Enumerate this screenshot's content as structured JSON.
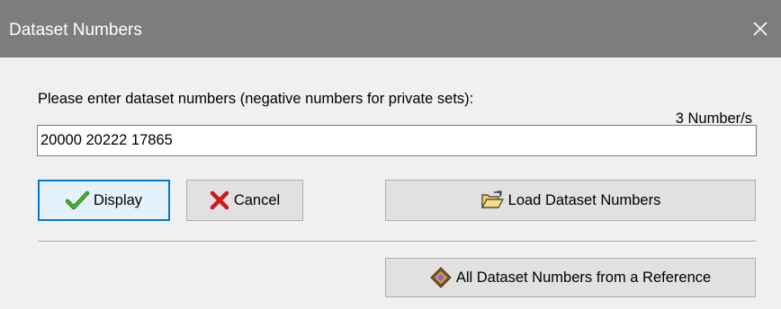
{
  "window": {
    "title": "Dataset Numbers",
    "close_icon": "close-icon"
  },
  "form": {
    "prompt": "Please enter dataset numbers (negative numbers for private sets):",
    "count_label": "3 Number/s",
    "input_value": "20000 20222 17865"
  },
  "buttons": {
    "display": {
      "label": "Display",
      "icon": "checkmark-icon",
      "icon_color": "#2e8b1f"
    },
    "cancel": {
      "label": "Cancel",
      "icon": "red-x-icon",
      "icon_color": "#cc1a1a"
    },
    "load": {
      "label": "Load Dataset Numbers",
      "icon": "open-folder-icon"
    },
    "reference": {
      "label": "All Dataset Numbers from a Reference",
      "icon": "book-icon"
    }
  },
  "colors": {
    "titlebar": "#7d7d7d",
    "dialog_bg": "#f0f0f0",
    "focus_border": "#0078d7"
  }
}
